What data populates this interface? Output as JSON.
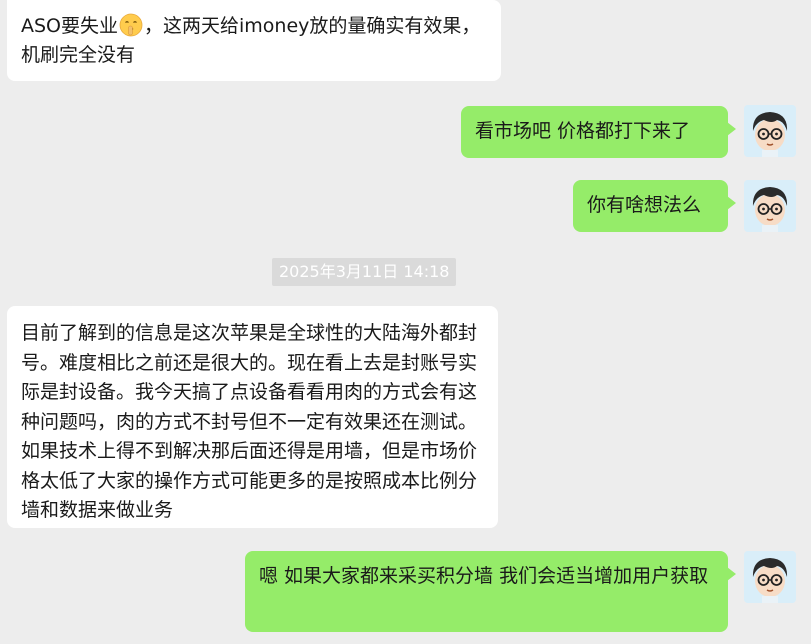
{
  "chat": {
    "timestamp": "2025年3月11日 14:18",
    "messages": [
      {
        "side": "incoming",
        "text_before_emoji": "ASO要失业",
        "emoji": "shushing-face-emoji",
        "text_after_emoji": "，这两天给imoney放的量确实有效果，机刷完全没有"
      },
      {
        "side": "outgoing",
        "text": "看市场吧 价格都打下来了"
      },
      {
        "side": "outgoing",
        "text": "你有啥想法么"
      },
      {
        "side": "incoming",
        "text": "目前了解到的信息是这次苹果是全球性的大陆海外都封号。难度相比之前还是很大的。现在看上去是封账号实际是封设备。我今天搞了点设备看看用肉的方式会有这种问题吗，肉的方式不封号但不一定有效果还在测试。如果技术上得不到解决那后面还得是用墙，但是市场价格太低了大家的操作方式可能更多的是按照成本比例分墙和数据来做业务"
      },
      {
        "side": "outgoing",
        "text": "嗯 如果大家都来采买积分墙 我们会适当增加用户获取"
      }
    ]
  },
  "colors": {
    "background": "#ededed",
    "incoming_bubble": "#ffffff",
    "outgoing_bubble": "#95ec69",
    "timestamp_bg": "#dadada"
  },
  "icons": {
    "avatar": "cartoon-boy-with-glasses-avatar"
  }
}
